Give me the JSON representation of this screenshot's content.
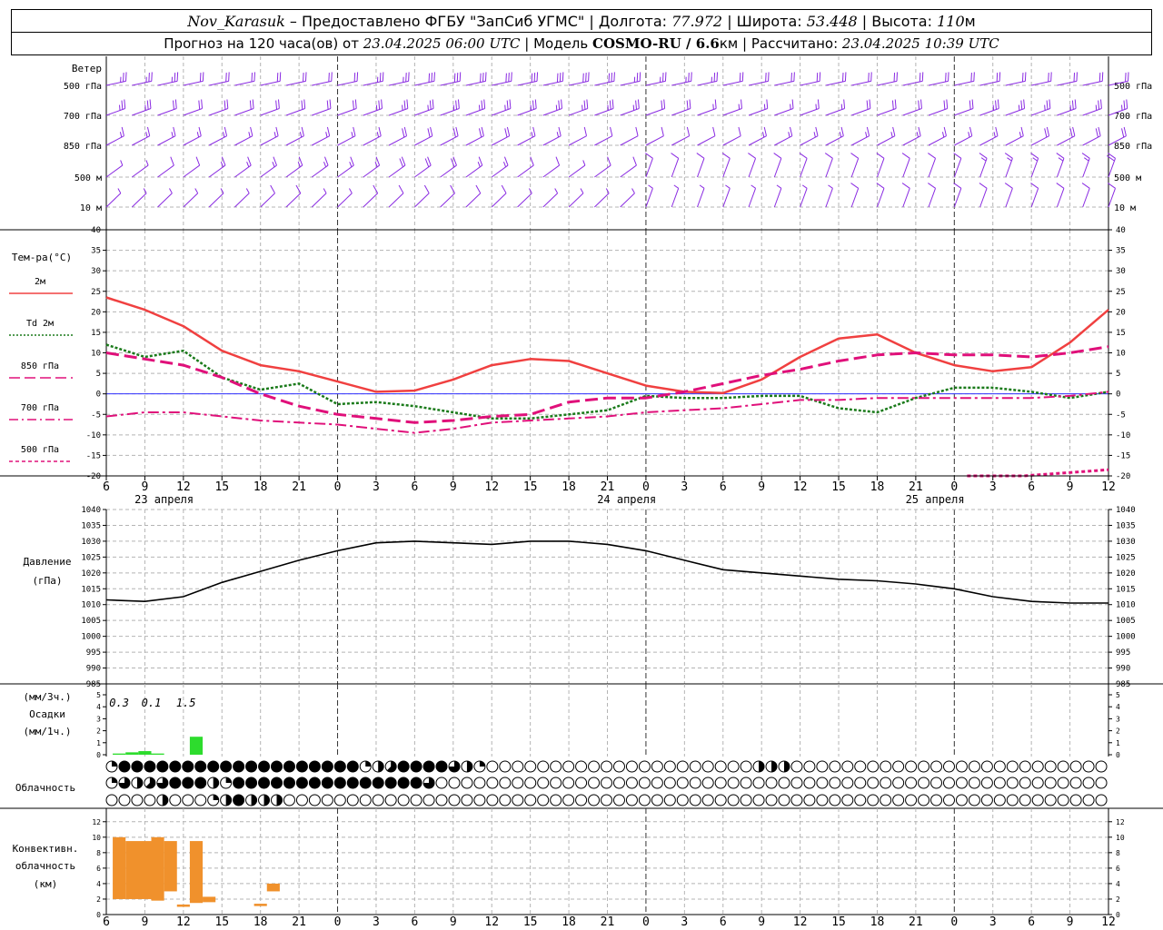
{
  "header": {
    "station": "Nov_Karasuk",
    "provided": " – Предоставлено ФГБУ \"ЗапСиб УГМС\" | Долгота: ",
    "lon": "77.972",
    "lat_label": " | Широта: ",
    "lat": "53.448",
    "alt_label": " | Высота: ",
    "alt": "110",
    "alt_unit": "м",
    "forecast": "Прогноз на 120 часа(ов) от ",
    "start": "23.04.2025 06:00 UTC",
    "model_label": " | Модель ",
    "model": "COSMO-RU / 6.6",
    "model_unit": "км",
    "calc_label": " | Рассчитано: ",
    "calc": "23.04.2025 10:39 UTC"
  },
  "panels": {
    "wind": {
      "title": "Ветер",
      "levels": [
        "500 гПа",
        "700 гПа",
        "850 гПа",
        "500 м",
        "10  м"
      ]
    },
    "temp": {
      "title": "Тем-ра(°C)",
      "legend": [
        {
          "label": "2м",
          "color": "#f04040",
          "dash": "solid"
        },
        {
          "label": "Td  2м",
          "color": "#1a7a1a",
          "dash": "dot"
        },
        {
          "label": "850 гПа",
          "color": "#e0107a",
          "dash": "long"
        },
        {
          "label": "700 гПа",
          "color": "#e0107a",
          "dash": "dashdot"
        },
        {
          "label": "500 гПа",
          "color": "#e0107a",
          "dash": "short"
        }
      ],
      "yticks": [
        "40",
        "35",
        "30",
        "25",
        "20",
        "15",
        "10",
        "5",
        "0",
        "-5",
        "-10",
        "-15",
        "-20"
      ]
    },
    "pressure": {
      "title1": "Давление",
      "title2": "(гПа)",
      "yticks": [
        "1040",
        "1035",
        "1030",
        "1025",
        "1020",
        "1015",
        "1010",
        "1005",
        "1000",
        "995",
        "990",
        "985"
      ]
    },
    "precip": {
      "title1": "(мм/3ч.)",
      "title2": "Осадки",
      "title3": "(мм/1ч.)",
      "yticks": [
        "5",
        "4",
        "3",
        "2",
        "1",
        "0"
      ],
      "labels": [
        "0.3",
        "0.1",
        "1.5"
      ]
    },
    "cloud": {
      "title": "Облачность"
    },
    "convect": {
      "title1": "Конвективн.",
      "title2": "облачность",
      "title3": "(км)",
      "yticks": [
        "12",
        "10",
        "8",
        "6",
        "4",
        "2",
        "0"
      ]
    }
  },
  "x_axis": {
    "hour_labels": [
      "6",
      "9",
      "12",
      "15",
      "18",
      "21",
      "0",
      "3",
      "6",
      "9",
      "12",
      "15",
      "18",
      "21",
      "0",
      "3",
      "6",
      "9",
      "12",
      "15",
      "18",
      "21",
      "0",
      "3",
      "6",
      "9",
      "12"
    ],
    "dates": [
      "23 апреля",
      "24 апреля",
      "25 апреля"
    ]
  },
  "chart_data": {
    "type": "line",
    "x_hours": [
      0,
      3,
      6,
      9,
      12,
      15,
      18,
      21,
      24,
      27,
      30,
      33,
      36,
      39,
      42,
      45,
      48,
      51,
      54,
      57,
      60,
      63,
      66,
      69,
      72,
      75,
      78
    ],
    "series": [
      {
        "name": "2м",
        "unit": "°C",
        "values": [
          23.5,
          20.5,
          16.5,
          10.5,
          7.0,
          5.5,
          3.0,
          0.5,
          0.8,
          3.5,
          7.0,
          8.5,
          8.0,
          5.0,
          2.0,
          0.5,
          0.2,
          3.5,
          9.0,
          13.5,
          14.5,
          10.0,
          7.0,
          5.5,
          6.5,
          12.5,
          20.5
        ]
      },
      {
        "name": "Td  2м",
        "unit": "°C",
        "values": [
          12.0,
          9.0,
          10.5,
          4.0,
          1.0,
          2.5,
          -2.5,
          -2.0,
          -3.0,
          -4.5,
          -6.0,
          -6.0,
          -5.0,
          -4.0,
          -0.5,
          -1.0,
          -1.0,
          -0.5,
          -0.5,
          -3.5,
          -4.5,
          -1.0,
          1.5,
          1.5,
          0.5,
          -1.0,
          0.5
        ]
      },
      {
        "name": "850 гПа",
        "unit": "°C",
        "values": [
          10.0,
          8.5,
          7.0,
          4.0,
          0.0,
          -3.0,
          -5.0,
          -6.0,
          -7.0,
          -6.5,
          -5.5,
          -5.0,
          -2.0,
          -1.0,
          -1.0,
          0.5,
          2.5,
          4.5,
          6.0,
          8.0,
          9.5,
          10.0,
          9.5,
          9.5,
          9.0,
          10.0,
          11.5
        ]
      },
      {
        "name": "700 гПа",
        "unit": "°C",
        "values": [
          -5.5,
          -4.5,
          -4.5,
          -5.5,
          -6.5,
          -7.0,
          -7.5,
          -8.5,
          -9.5,
          -8.5,
          -7.0,
          -6.5,
          -6.0,
          -5.5,
          -4.5,
          -4.0,
          -3.5,
          -2.5,
          -1.5,
          -1.5,
          -1.0,
          -1.0,
          -1.0,
          -1.0,
          -1.0,
          -0.5,
          0.5
        ]
      },
      {
        "name": "500 гПа",
        "unit": "°C",
        "x_start": 67,
        "values": [
          -20.0,
          -20.0,
          -20.0,
          -19.5,
          -19.0,
          -18.5
        ]
      },
      {
        "name": "Давление",
        "unit": "гПа",
        "values": [
          1011.5,
          1011.0,
          1012.5,
          1017.0,
          1020.5,
          1024.0,
          1027.0,
          1029.5,
          1030.0,
          1029.5,
          1029.0,
          1030.0,
          1030.0,
          1029.0,
          1027.0,
          1024.0,
          1021.0,
          1020.0,
          1019.0,
          1018.0,
          1017.5,
          1016.5,
          1015.0,
          1012.5,
          1011.0,
          1010.5,
          1010.5
        ]
      }
    ],
    "precip_mm": {
      "unit": "мм/1ч",
      "bars": [
        {
          "h0": 0.5,
          "h1": 1.5,
          "v": 0.1
        },
        {
          "h0": 1.5,
          "h1": 2.5,
          "v": 0.2
        },
        {
          "h0": 2.5,
          "h1": 3.5,
          "v": 0.3
        },
        {
          "h0": 3.5,
          "h1": 4.5,
          "v": 0.1
        },
        {
          "h0": 6.5,
          "h1": 7.5,
          "v": 1.5
        }
      ]
    },
    "convective_km": {
      "bars": [
        {
          "h0": 0.5,
          "h1": 1.5,
          "base": 2.0,
          "top": 10.0
        },
        {
          "h0": 1.5,
          "h1": 3.5,
          "base": 2.0,
          "top": 9.5
        },
        {
          "h0": 3.5,
          "h1": 4.5,
          "base": 1.8,
          "top": 10.0
        },
        {
          "h0": 4.5,
          "h1": 5.5,
          "base": 3.0,
          "top": 9.5
        },
        {
          "h0": 5.5,
          "h1": 6.5,
          "base": 1.0,
          "top": 1.3
        },
        {
          "h0": 6.5,
          "h1": 7.5,
          "base": 1.5,
          "top": 9.5
        },
        {
          "h0": 7.5,
          "h1": 8.5,
          "base": 1.6,
          "top": 2.3
        },
        {
          "h0": 11.5,
          "h1": 12.5,
          "base": 1.1,
          "top": 1.4
        },
        {
          "h0": 12.5,
          "h1": 13.5,
          "base": 3.0,
          "top": 4.0
        }
      ]
    },
    "cloud_cover": {
      "rows": [
        "upper",
        "middle",
        "lower"
      ],
      "octas": [
        [
          2,
          8,
          8,
          8,
          8,
          8,
          8,
          8,
          8,
          8,
          8,
          8,
          8,
          8,
          8,
          8,
          8,
          8,
          8,
          8,
          2,
          4,
          5,
          8,
          8,
          8,
          8,
          6,
          4,
          2,
          0,
          0,
          0,
          0,
          0,
          0,
          0,
          0,
          0,
          0,
          0,
          0,
          0,
          0,
          0,
          0,
          0,
          0,
          0,
          0,
          0,
          4,
          4,
          4,
          0,
          0,
          0,
          0,
          0,
          0,
          0,
          0,
          0,
          0,
          0,
          0,
          0,
          0,
          0,
          0,
          0,
          0,
          0,
          0,
          0,
          0,
          0,
          0,
          0,
          0,
          0,
          0,
          0,
          2,
          0,
          0,
          0,
          0,
          0,
          0,
          2,
          0,
          0,
          0,
          0,
          0,
          2,
          0,
          0,
          0,
          0,
          4,
          0,
          0,
          0,
          0,
          0,
          0,
          0,
          0,
          0,
          0,
          0,
          0,
          0,
          0,
          0,
          0,
          0,
          4,
          0,
          0,
          2,
          4,
          0,
          0,
          0
        ],
        [
          2,
          6,
          4,
          5,
          6,
          8,
          8,
          8,
          4,
          2,
          8,
          8,
          8,
          8,
          8,
          8,
          8,
          8,
          8,
          8,
          8,
          8,
          8,
          8,
          8,
          6,
          0,
          0,
          0,
          0,
          0,
          0,
          0,
          0,
          0,
          0,
          0,
          0,
          0,
          0,
          0,
          0,
          0,
          0,
          0,
          0,
          0,
          0,
          0,
          0,
          0,
          0,
          0,
          0,
          0,
          0,
          0,
          0,
          0,
          0,
          0,
          0,
          0,
          0,
          0,
          0,
          0,
          0,
          0,
          0,
          0,
          0,
          0,
          0,
          0,
          0,
          0,
          0,
          0,
          0,
          0,
          0,
          0,
          0,
          0,
          0,
          0,
          0,
          0,
          0,
          0,
          0,
          0,
          0,
          0,
          0,
          0,
          0,
          0,
          0,
          0,
          0,
          0,
          0,
          0,
          0,
          0,
          0,
          0,
          0,
          0,
          0,
          0,
          0,
          0,
          0,
          0,
          0,
          0,
          0,
          0,
          0,
          0,
          0,
          0,
          0,
          0
        ],
        [
          0,
          0,
          0,
          0,
          4,
          0,
          0,
          0,
          2,
          4,
          8,
          4,
          4,
          4,
          0,
          0,
          0,
          0,
          0,
          0,
          0,
          0,
          0,
          0,
          0,
          0,
          0,
          0,
          0,
          0,
          0,
          0,
          0,
          0,
          0,
          0,
          0,
          0,
          0,
          0,
          0,
          0,
          0,
          0,
          0,
          0,
          0,
          0,
          0,
          0,
          0,
          0,
          0,
          0,
          0,
          0,
          0,
          0,
          0,
          0,
          0,
          0,
          0,
          0,
          0,
          0,
          0,
          0,
          0,
          0,
          0,
          0,
          0,
          0,
          0,
          0,
          0,
          0,
          0,
          0,
          0,
          0,
          0,
          0,
          0,
          0,
          0,
          0,
          0,
          0,
          0,
          0,
          0,
          0,
          0,
          0,
          0,
          0,
          0,
          0,
          0,
          0,
          0,
          0,
          0,
          0,
          0,
          0,
          0,
          0,
          0,
          0,
          0,
          0,
          0,
          0,
          0,
          0,
          0,
          0,
          0,
          0,
          0,
          0,
          0,
          0,
          0
        ]
      ]
    },
    "wind_barbs": {
      "levels": [
        "500 гПа",
        "700 гПа",
        "850 гПа",
        "500 м",
        "10  м"
      ],
      "x_hours": [
        0,
        6,
        12,
        18,
        24,
        30,
        36,
        42,
        48,
        54,
        60,
        66,
        72,
        78
      ],
      "speed_ms": [
        [
          25,
          22,
          22,
          20,
          30,
          30,
          30,
          25,
          22,
          20,
          20,
          20,
          20,
          22
        ],
        [
          25,
          20,
          18,
          22,
          25,
          25,
          25,
          22,
          15,
          15,
          20,
          22,
          25,
          25
        ],
        [
          15,
          15,
          15,
          15,
          20,
          20,
          10,
          12,
          12,
          15,
          15,
          15,
          18,
          20
        ],
        [
          5,
          12,
          15,
          15,
          20,
          15,
          7,
          10,
          10,
          10,
          12,
          12,
          15,
          18
        ],
        [
          3,
          5,
          8,
          7,
          10,
          8,
          3,
          5,
          7,
          7,
          8,
          8,
          10,
          10
        ]
      ]
    },
    "colors": {
      "wind": "#8a2be2",
      "t2m": "#f04040",
      "td": "#1a7a1a",
      "upper": "#e0107a",
      "pressure": "#000000",
      "precip": "#2ddc2d",
      "convective": "#f0912c",
      "grid": "#b4b4b4"
    }
  }
}
